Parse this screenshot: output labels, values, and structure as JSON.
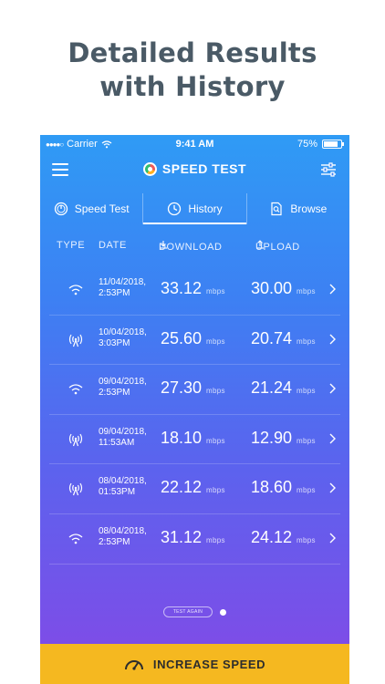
{
  "headline": {
    "line1": "Detailed Results",
    "line2": "with History"
  },
  "status_bar": {
    "carrier": "Carrier",
    "time": "9:41 AM",
    "battery": "75%"
  },
  "app_bar": {
    "title": "SPEED TEST"
  },
  "tabs": [
    {
      "label": "Speed Test",
      "icon": "gauge-icon",
      "active": false
    },
    {
      "label": "History",
      "icon": "clock-icon",
      "active": true
    },
    {
      "label": "Browse",
      "icon": "search-doc-icon",
      "active": false
    }
  ],
  "columns": {
    "type": "TYPE",
    "date": "DATE",
    "download": "DOWNLOAD",
    "upload": "UPLOAD"
  },
  "unit": "mbps",
  "history": [
    {
      "type": "wifi",
      "date": "11/04/2018,",
      "time": "2:53PM",
      "download": "33.12",
      "upload": "30.00"
    },
    {
      "type": "cellular",
      "date": "10/04/2018,",
      "time": "3:03PM",
      "download": "25.60",
      "upload": "20.74"
    },
    {
      "type": "wifi",
      "date": "09/04/2018,",
      "time": "2:53PM",
      "download": "27.30",
      "upload": "21.24"
    },
    {
      "type": "cellular",
      "date": "09/04/2018,",
      "time": "11:53AM",
      "download": "18.10",
      "upload": "12.90"
    },
    {
      "type": "cellular",
      "date": "08/04/2018,",
      "time": "01:53PM",
      "download": "22.12",
      "upload": "18.60"
    },
    {
      "type": "wifi",
      "date": "08/04/2018,",
      "time": "2:53PM",
      "download": "31.12",
      "upload": "24.12"
    }
  ],
  "pager": {
    "pill_label": "TEST AGAIN"
  },
  "cta": {
    "label": "INCREASE SPEED",
    "color": "#f5b820"
  },
  "colors": {
    "gradient_top": "#2f9bf5",
    "gradient_bottom": "#8448e4",
    "headline": "#4a5a66"
  }
}
